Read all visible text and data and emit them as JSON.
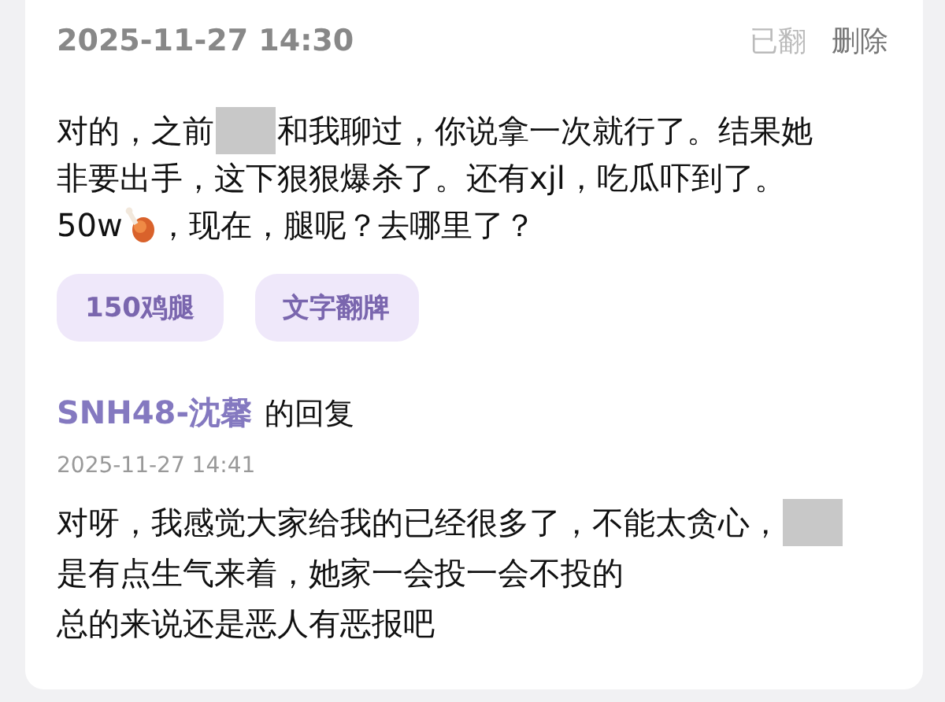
{
  "post": {
    "time": "2025-11-27 14:30",
    "actions": [
      {
        "label": "已翻",
        "disabled": true
      },
      {
        "label": "删除",
        "disabled": false
      }
    ],
    "lines": [
      [
        {
          "kind": "text",
          "text": "对的，之前"
        },
        {
          "kind": "redacted"
        },
        {
          "kind": "text",
          "text": "和我聊过，你说拿一次就行了。结果她"
        }
      ],
      [
        {
          "kind": "text",
          "text": "非要出手，这下狠狠爆杀了。还有xjl，吃瓜吓到了。"
        }
      ],
      [
        {
          "kind": "text",
          "text": "50w"
        },
        {
          "kind": "emoji"
        },
        {
          "kind": "text",
          "text": "，现在，腿呢？去哪里了？"
        }
      ]
    ],
    "tags": [
      "150鸡腿",
      "文字翻牌"
    ]
  },
  "reply": {
    "author": "SNH48-沈馨",
    "suffix": "的回复",
    "time": "2025-11-27 14:41",
    "lines": [
      [
        {
          "kind": "text",
          "text": "对呀，我感觉大家给我的已经很多了，不能太贪心，"
        },
        {
          "kind": "redacted"
        }
      ],
      [
        {
          "kind": "text",
          "text": "是有点生气来着，她家一会投一会不投的"
        }
      ],
      [
        {
          "kind": "text",
          "text": "总的来说还是恶人有恶报吧"
        }
      ]
    ]
  }
}
